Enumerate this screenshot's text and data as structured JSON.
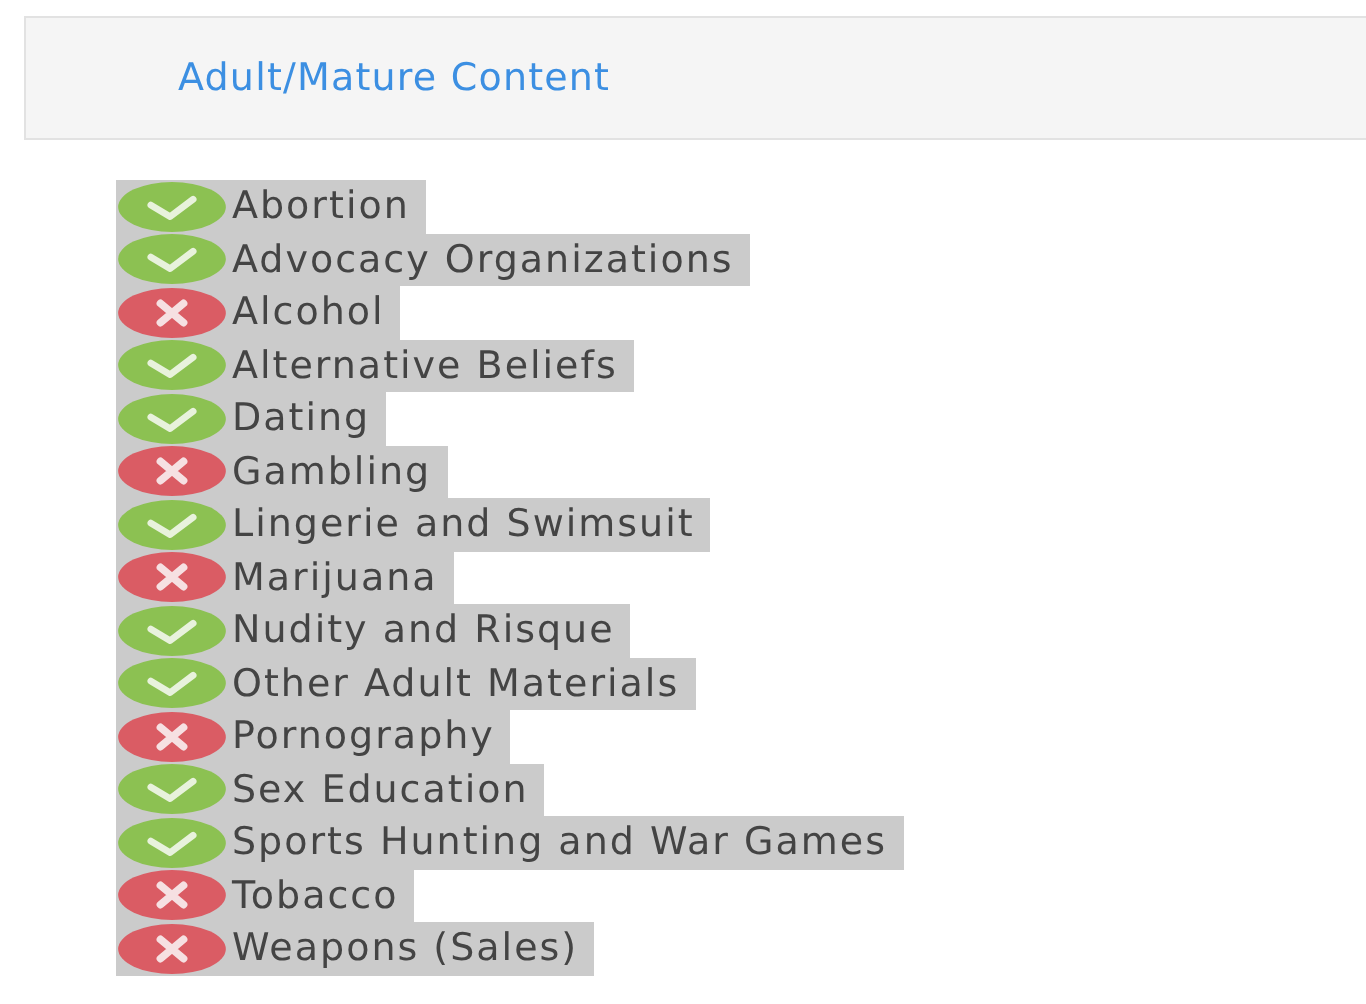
{
  "panel": {
    "title": "Adult/Mature Content"
  },
  "categories": [
    {
      "label": "Abortion",
      "allowed": true
    },
    {
      "label": "Advocacy Organizations",
      "allowed": true
    },
    {
      "label": "Alcohol",
      "allowed": false
    },
    {
      "label": "Alternative Beliefs",
      "allowed": true
    },
    {
      "label": "Dating",
      "allowed": true
    },
    {
      "label": "Gambling",
      "allowed": false
    },
    {
      "label": "Lingerie and Swimsuit",
      "allowed": true
    },
    {
      "label": "Marijuana",
      "allowed": false
    },
    {
      "label": "Nudity and Risque",
      "allowed": true
    },
    {
      "label": "Other Adult Materials",
      "allowed": true
    },
    {
      "label": "Pornography",
      "allowed": false
    },
    {
      "label": "Sex Education",
      "allowed": true
    },
    {
      "label": "Sports Hunting and War Games",
      "allowed": true
    },
    {
      "label": "Tobacco",
      "allowed": false
    },
    {
      "label": "Weapons (Sales)",
      "allowed": false
    }
  ]
}
